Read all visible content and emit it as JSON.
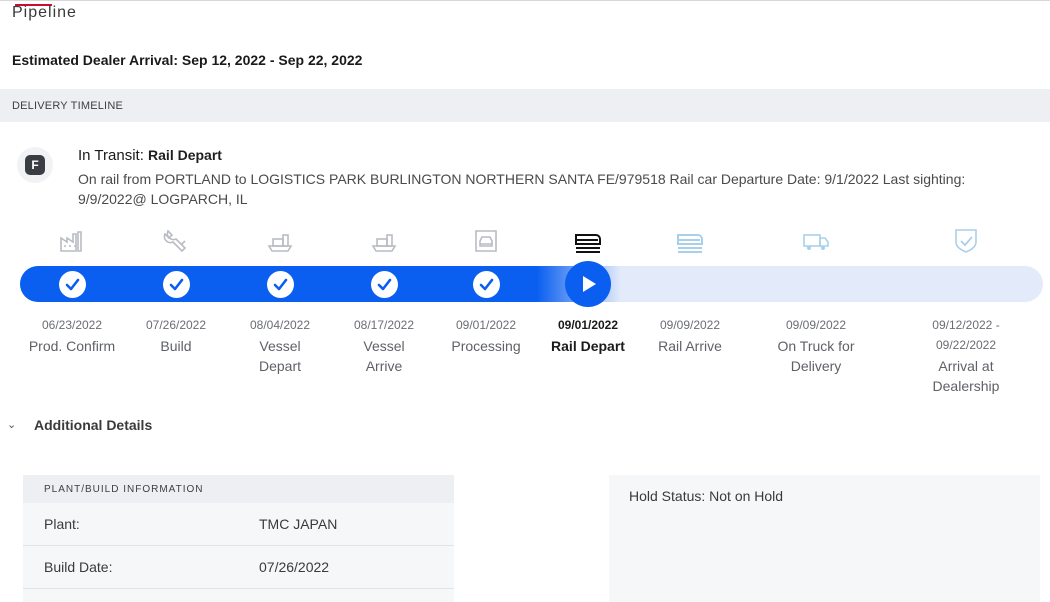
{
  "page": {
    "title": "Pipeline",
    "eta": "Estimated Dealer Arrival: Sep 12, 2022 - Sep 22, 2022"
  },
  "delivery_timeline": {
    "heading": "DELIVERY TIMELINE",
    "badge": "F",
    "status_key": "In Transit:",
    "status_value": "Rail Depart",
    "description": "On rail from PORTLAND to LOGISTICS PARK BURLINGTON NORTHERN SANTA FE/979518 Rail car Departure Date: 9/1/2022 Last sighting: 9/9/2022@ LOGPARCH, IL",
    "progress_fraction": 0.56,
    "stages": [
      {
        "date": "06/23/2022",
        "label": "Prod. Confirm",
        "state": "done",
        "icon": "factory-icon"
      },
      {
        "date": "07/26/2022",
        "label": "Build",
        "state": "done",
        "icon": "wrench-icon"
      },
      {
        "date": "08/04/2022",
        "label": "Vessel Depart",
        "state": "done",
        "icon": "ship-icon"
      },
      {
        "date": "08/17/2022",
        "label": "Vessel Arrive",
        "state": "done",
        "icon": "ship-icon"
      },
      {
        "date": "09/01/2022",
        "label": "Processing",
        "state": "done",
        "icon": "car-icon"
      },
      {
        "date": "09/01/2022",
        "label": "Rail Depart",
        "state": "current",
        "icon": "train-icon"
      },
      {
        "date": "09/09/2022",
        "label": "Rail Arrive",
        "state": "upcoming",
        "icon": "train-icon"
      },
      {
        "date": "09/09/2022",
        "label": "On Truck for Delivery",
        "state": "upcoming",
        "icon": "truck-icon"
      },
      {
        "date": "09/12/2022 - 09/22/2022",
        "label": "Arrival at Dealership",
        "state": "upcoming",
        "icon": "shield-check-icon"
      }
    ]
  },
  "additional_details": {
    "label": "Additional Details"
  },
  "plant_info": {
    "heading": "PLANT/BUILD INFORMATION",
    "rows": [
      {
        "label": "Plant:",
        "value": "TMC JAPAN"
      },
      {
        "label": "Build Date:",
        "value": "07/26/2022"
      }
    ]
  },
  "hold": {
    "text": "Hold Status: Not on Hold"
  },
  "colors": {
    "accent": "#0a5ff0",
    "track": "#e3ebfb",
    "done_icon": "#b8bcc2",
    "upcoming_icon": "#a9d0ea"
  }
}
